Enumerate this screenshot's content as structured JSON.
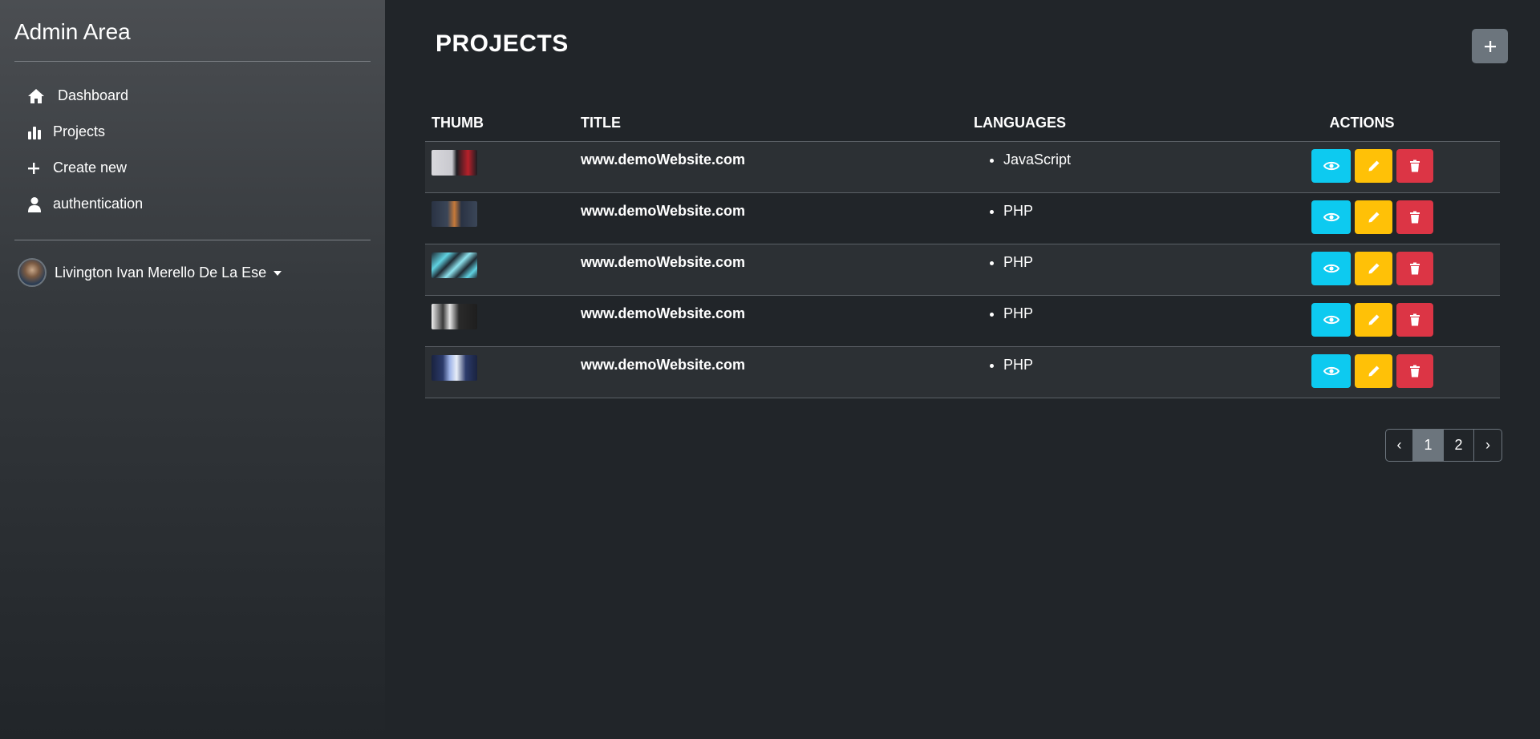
{
  "sidebar": {
    "brand": "Admin Area",
    "items": [
      {
        "label": "Dashboard",
        "icon": "home-icon"
      },
      {
        "label": "Projects",
        "icon": "bar-chart-icon"
      },
      {
        "label": "Create new",
        "icon": "plus-icon"
      },
      {
        "label": "authentication",
        "icon": "user-icon"
      }
    ],
    "user": {
      "name": "Livington Ivan Merello De La Ese"
    }
  },
  "main": {
    "title": "PROJECTS",
    "add_label": "+",
    "table": {
      "headers": {
        "thumb": "THUMB",
        "title": "TITLE",
        "languages": "LANGUAGES",
        "actions": "ACTIONS"
      },
      "rows": [
        {
          "title": "www.demoWebsite.com",
          "language": "JavaScript"
        },
        {
          "title": "www.demoWebsite.com",
          "language": "PHP"
        },
        {
          "title": "www.demoWebsite.com",
          "language": "PHP"
        },
        {
          "title": "www.demoWebsite.com",
          "language": "PHP"
        },
        {
          "title": "www.demoWebsite.com",
          "language": "PHP"
        }
      ]
    },
    "pagination": {
      "prev": "‹",
      "pages": [
        "1",
        "2"
      ],
      "next": "›",
      "active": "1"
    }
  },
  "colors": {
    "view": "#0dcaf0",
    "edit": "#ffc107",
    "delete": "#dc3545",
    "secondary": "#6c757d",
    "background": "#212529"
  }
}
